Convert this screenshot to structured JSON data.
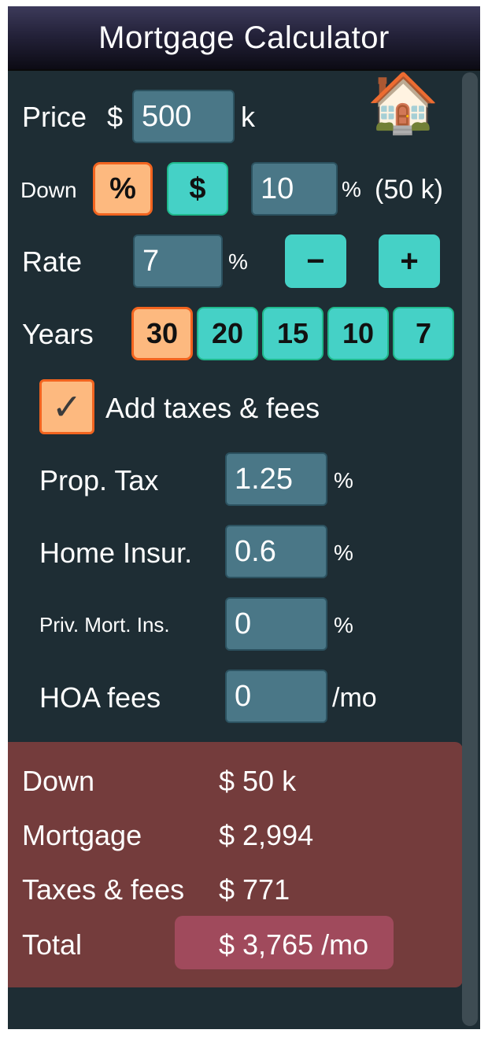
{
  "title": "Mortgage Calculator",
  "icons": {
    "house": "house-icon",
    "house_glyph": "🏠",
    "check_glyph": "✓"
  },
  "colors": {
    "background": "#1e2d34",
    "input_bg": "#4a7787",
    "teal_button": "#45d1c6",
    "orange_button": "#fdb97f",
    "orange_border": "#f2641f",
    "summary_bg": "#743c3c",
    "total_bg": "#a04a5c"
  },
  "price": {
    "label": "Price",
    "currency": "$",
    "value": "500",
    "unit": "k"
  },
  "down": {
    "label": "Down",
    "percent_button": "%",
    "dollar_button": "$",
    "selected_mode": "%",
    "value": "10",
    "unit": "%",
    "computed": "(50 k)"
  },
  "rate": {
    "label": "Rate",
    "value": "7",
    "unit": "%",
    "minus": "−",
    "plus": "+"
  },
  "years": {
    "label": "Years",
    "options": [
      "30",
      "20",
      "15",
      "10",
      "7"
    ],
    "selected": "30"
  },
  "taxes": {
    "checkbox_label": "Add taxes & fees",
    "checked": true,
    "prop_tax": {
      "label": "Prop. Tax",
      "value": "1.25",
      "unit": "%"
    },
    "home_insur": {
      "label": "Home Insur.",
      "value": "0.6",
      "unit": "%"
    },
    "pmi": {
      "label": "Priv. Mort. Ins.",
      "value": "0",
      "unit": "%"
    },
    "hoa": {
      "label": "HOA fees",
      "value": "0",
      "unit": "/mo"
    }
  },
  "summary": {
    "down": {
      "label": "Down",
      "value": "$ 50 k"
    },
    "mortgage": {
      "label": "Mortgage",
      "value": "$ 2,994"
    },
    "taxes": {
      "label": "Taxes & fees",
      "value": "$ 771"
    },
    "total": {
      "label": "Total",
      "value": "$ 3,765 /mo"
    }
  }
}
